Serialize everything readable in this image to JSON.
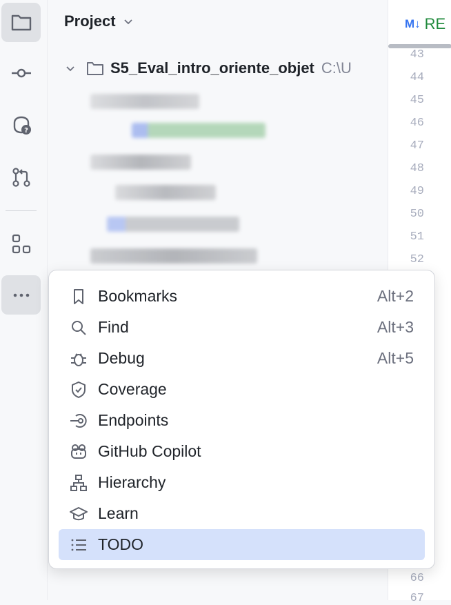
{
  "project_panel": {
    "title": "Project",
    "root": {
      "name": "S5_Eval_intro_oriente_objet",
      "path": "C:\\U"
    }
  },
  "editor": {
    "tab": {
      "icon": "M↓",
      "label": "RE"
    },
    "line_numbers_top": [
      "43",
      "44",
      "45",
      "46",
      "47",
      "48",
      "49",
      "50",
      "51",
      "52"
    ],
    "line_numbers_bottom": [
      "66",
      "67"
    ]
  },
  "tool_strip": {
    "buttons": [
      "folder-icon",
      "commit-icon",
      "ai-assistant-icon",
      "pull-requests-icon",
      "structure-icon",
      "more-icon"
    ],
    "active": [
      "folder-icon",
      "more-icon"
    ]
  },
  "popup": {
    "items": [
      {
        "label": "Bookmarks",
        "shortcut": "Alt+2",
        "icon": "bookmark-icon"
      },
      {
        "label": "Find",
        "shortcut": "Alt+3",
        "icon": "search-icon"
      },
      {
        "label": "Debug",
        "shortcut": "Alt+5",
        "icon": "bug-icon"
      },
      {
        "label": "Coverage",
        "shortcut": "",
        "icon": "shield-check-icon"
      },
      {
        "label": "Endpoints",
        "shortcut": "",
        "icon": "endpoints-icon"
      },
      {
        "label": "GitHub Copilot",
        "shortcut": "",
        "icon": "copilot-icon"
      },
      {
        "label": "Hierarchy",
        "shortcut": "",
        "icon": "hierarchy-icon"
      },
      {
        "label": "Learn",
        "shortcut": "",
        "icon": "graduation-cap-icon"
      },
      {
        "label": "TODO",
        "shortcut": "",
        "icon": "list-icon",
        "selected": true
      }
    ]
  },
  "colors": {
    "accent": "#3574f0",
    "selection": "#d5e1fb",
    "file_green": "#208a3c"
  }
}
